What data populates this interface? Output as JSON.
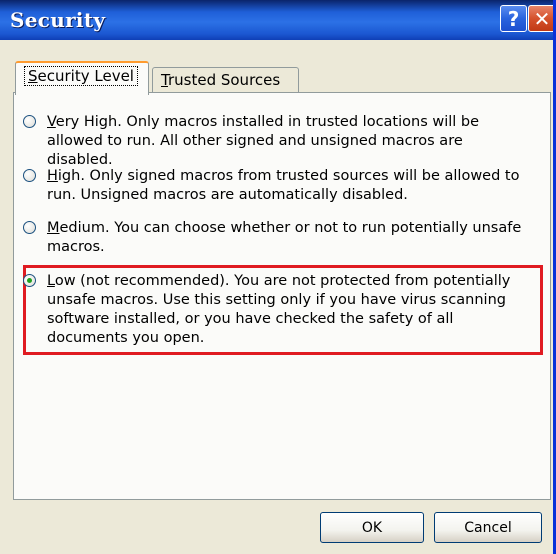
{
  "window": {
    "title": "Security",
    "help_label": "?",
    "close_label": "✕"
  },
  "tabs": [
    {
      "label": "Security Level",
      "accel": "S",
      "rest": "ecurity Level",
      "active": true
    },
    {
      "label": "Trusted Sources",
      "accel": "T",
      "rest": "rusted Sources",
      "active": false
    }
  ],
  "options": [
    {
      "accel": "V",
      "text": "ery High. Only macros installed in trusted locations will be allowed to run. All other signed and unsigned macros are disabled.",
      "checked": false
    },
    {
      "accel": "H",
      "text": "igh. Only signed macros from trusted sources will be allowed to run. Unsigned macros are automatically disabled.",
      "checked": false
    },
    {
      "accel": "M",
      "text": "edium. You can choose whether or not to run potentially unsafe macros.",
      "checked": false
    },
    {
      "accel": "L",
      "text": "ow (not recommended). You are not protected from potentially unsafe macros. Use this setting only if you have virus scanning software installed, or you have checked the safety of all documents you open.",
      "checked": true
    }
  ],
  "buttons": {
    "ok": "OK",
    "cancel": "Cancel"
  },
  "colors": {
    "highlight": "#e01b22",
    "titlebar": "#2c71e6"
  }
}
